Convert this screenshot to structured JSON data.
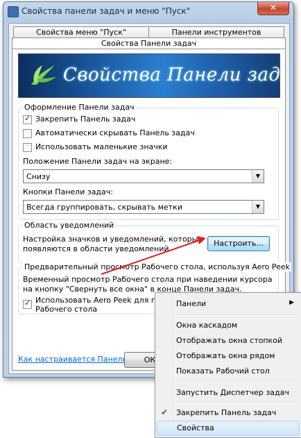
{
  "window": {
    "title": "Свойства панели задач и меню \"Пуск\"",
    "close": "✕"
  },
  "tabs": {
    "row1": [
      "Свойства меню \"Пуск\"",
      "Панели инструментов"
    ],
    "active": "Свойства Панели задач"
  },
  "banner": {
    "text": "Свойства Панели задач"
  },
  "appearance": {
    "legend": "Оформление Панели задач",
    "lock": "Закрепить Панель задач",
    "autohide": "Автоматически скрывать Панель задач",
    "small_icons": "Использовать маленькие значки",
    "position_label": "Положение Панели задач на экране:",
    "position_value": "Снизу",
    "buttons_label": "Кнопки Панели задач:",
    "buttons_value": "Всегда группировать, скрывать метки"
  },
  "notify": {
    "legend": "Область уведомлений",
    "text1": "Настройка значков и уведомлений, которые",
    "text2": "появляются в области уведомлений.",
    "button": "Настроить..."
  },
  "peek": {
    "legend": "Предварительный просмотр Рабочего стола, используя Aero Peek",
    "text1": "Временный просмотр Рабочего стола при наведении курсора",
    "text2": "на кнопку \"Свернуть все окна\" в конце Панели задач.",
    "check1": "Использовать Aero Peek для пре",
    "check2": "Рабочего стола"
  },
  "help_link": "Как настраивается Панель задач?",
  "ok_button": "ОК",
  "context_menu": {
    "items": [
      "Панели",
      "Окна каскадом",
      "Отображать окна стопкой",
      "Отображать окна рядом",
      "Показать Рабочий стол",
      "Запустить Диспетчер задач",
      "Закрепить Панель задач",
      "Свойства"
    ]
  },
  "colors": {
    "accent": "#0066cc",
    "arrow": "#e0201f"
  }
}
